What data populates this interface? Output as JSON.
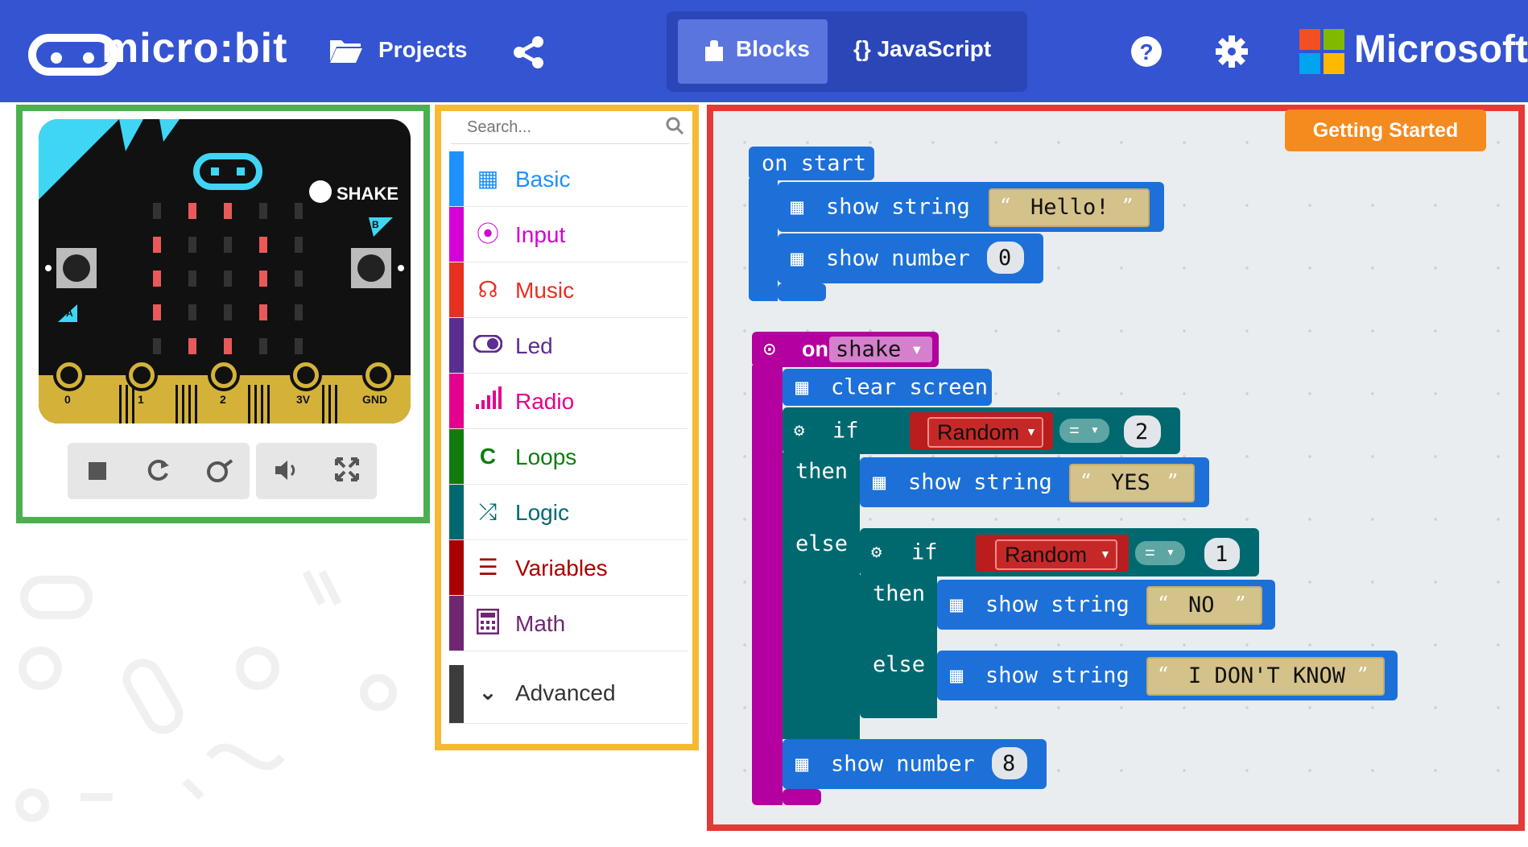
{
  "header": {
    "brand": "micro:bit",
    "projects_label": "Projects",
    "tab_blocks": "Blocks",
    "tab_javascript": "{} JavaScript",
    "microsoft_label": "Microsoft",
    "bg_color": "#3454d1"
  },
  "simulator": {
    "shake_label": "SHAKE",
    "button_a": "A",
    "button_b": "B",
    "pins": [
      "0",
      "1",
      "2",
      "3V",
      "GND"
    ],
    "controls": [
      "stop",
      "restart",
      "slow-mo",
      "mute",
      "fullscreen"
    ]
  },
  "toolbox": {
    "search_placeholder": "Search...",
    "categories": [
      {
        "label": "Basic",
        "color": "#1e90ff",
        "icon": "grid-icon"
      },
      {
        "label": "Input",
        "color": "#d400d4",
        "icon": "target-icon"
      },
      {
        "label": "Music",
        "color": "#e63022",
        "icon": "headphones-icon"
      },
      {
        "label": "Led",
        "color": "#5c2d91",
        "icon": "toggle-icon"
      },
      {
        "label": "Radio",
        "color": "#e3008c",
        "icon": "signal-icon"
      },
      {
        "label": "Loops",
        "color": "#107c10",
        "icon": "refresh-icon"
      },
      {
        "label": "Logic",
        "color": "#006970",
        "icon": "shuffle-icon"
      },
      {
        "label": "Variables",
        "color": "#a80000",
        "icon": "lines-icon"
      },
      {
        "label": "Math",
        "color": "#712672",
        "icon": "calculator-icon"
      }
    ],
    "advanced_label": "Advanced"
  },
  "workspace": {
    "getting_started": "Getting Started",
    "on_start": "on start",
    "show_string": "show string",
    "show_number": "show number",
    "hello": "Hello!",
    "zero": "0",
    "on": "on",
    "shake": "shake",
    "clear_screen": "clear screen",
    "if": "if",
    "then": "then",
    "else": "else",
    "random": "Random",
    "equals": "=",
    "two": "2",
    "one": "1",
    "yes": "YES",
    "no": "NO",
    "i_dont_know": "I DON'T KNOW",
    "eight": "8"
  }
}
